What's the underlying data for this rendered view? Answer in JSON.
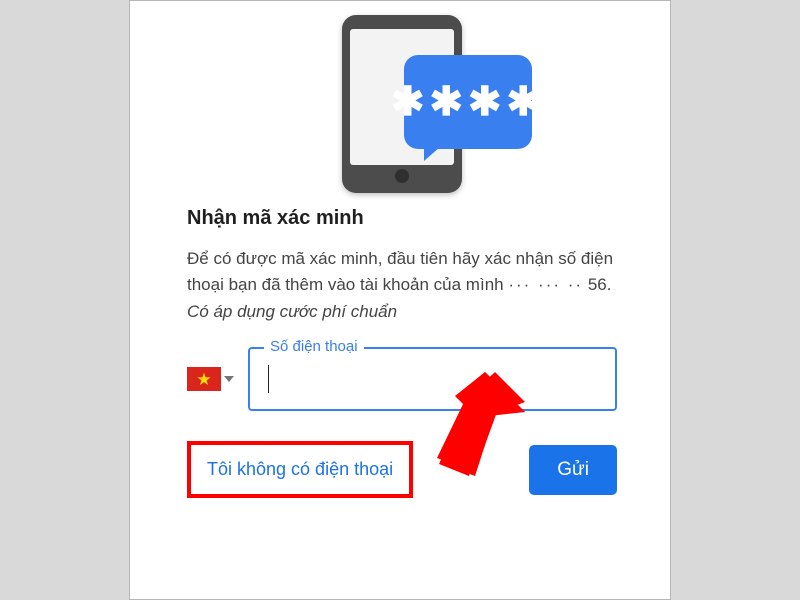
{
  "hero": {
    "bubble_text": "✱✱✱✱"
  },
  "title": "Nhận mã xác minh",
  "description": {
    "line1": "Để có được mã xác minh, đầu tiên hãy xác nhận số điện thoại bạn đã thêm vào tài khoản của mình",
    "masked": "··· ··· ··",
    "line2_prefix": "56.",
    "italic": "Có áp dụng cước phí chuẩn"
  },
  "phone_field": {
    "label": "Số điện thoại",
    "value": "",
    "country_flag": "★"
  },
  "actions": {
    "no_phone_link": "Tôi không có điện thoại",
    "send_button": "Gửi"
  }
}
